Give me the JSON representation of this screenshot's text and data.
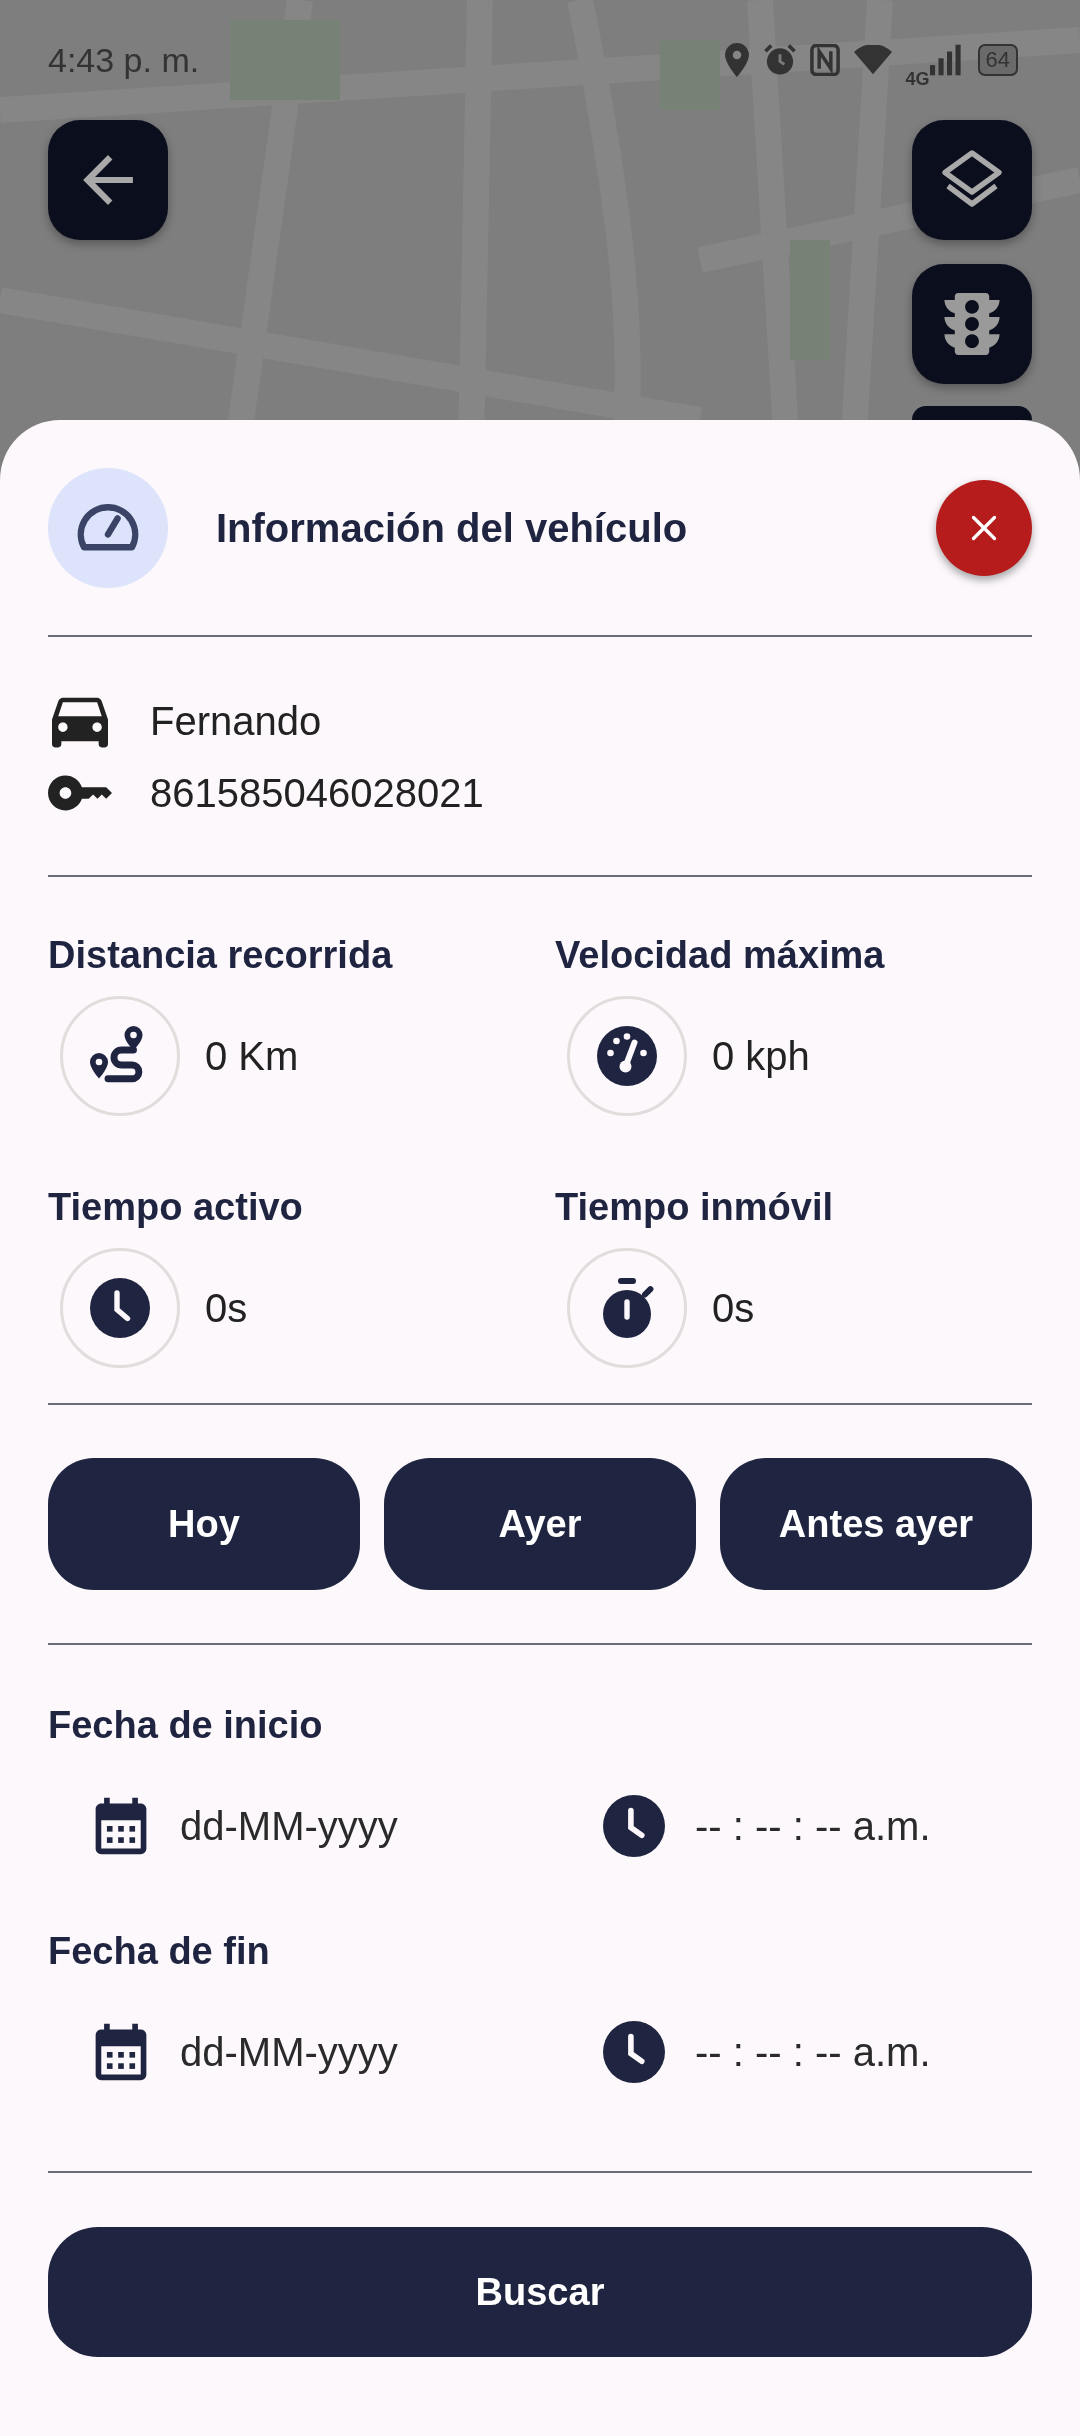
{
  "status_bar": {
    "time": "4:43 p. m.",
    "network": "4G",
    "battery": "64"
  },
  "sheet": {
    "title": "Información del vehículo"
  },
  "vehicle": {
    "name": "Fernando",
    "imei": "861585046028021"
  },
  "stats": [
    {
      "kind": "distance",
      "label": "Distancia recorrida",
      "value": "0 Km"
    },
    {
      "kind": "speed",
      "label": "Velocidad máxima",
      "value": "0 kph"
    },
    {
      "kind": "active",
      "label": "Tiempo activo",
      "value": "0s"
    },
    {
      "kind": "idle",
      "label": "Tiempo inmóvil",
      "value": "0s"
    }
  ],
  "quick_ranges": [
    {
      "label": "Hoy"
    },
    {
      "label": "Ayer"
    },
    {
      "label": "Antes ayer"
    }
  ],
  "date_ranges": [
    {
      "label": "Fecha de inicio",
      "date_placeholder": "dd-MM-yyyy",
      "time_placeholder": "-- : -- : -- a.m."
    },
    {
      "label": "Fecha de fin",
      "date_placeholder": "dd-MM-yyyy",
      "time_placeholder": "-- : -- : -- a.m."
    }
  ],
  "search_button": "Buscar"
}
